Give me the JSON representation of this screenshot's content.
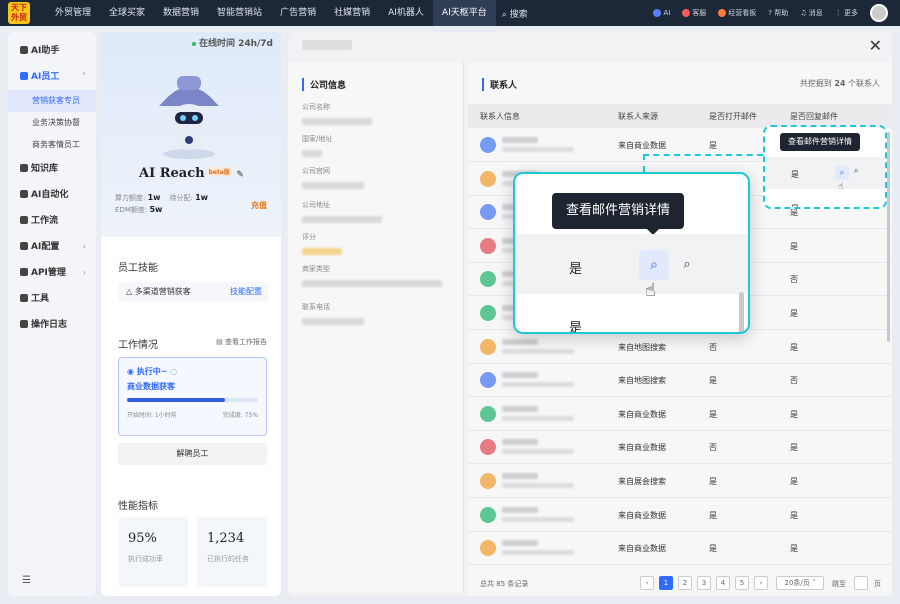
{
  "topnav": {
    "logo_text": "天下\n外贸",
    "items": [
      "外贸管理",
      "全球买家",
      "数据营销",
      "智能营销站",
      "广告营销",
      "社媒营销",
      "AI机器人",
      "AI天枢平台"
    ],
    "search": "搜索",
    "right": [
      "AI",
      "客服",
      "经营看板",
      "帮助",
      "消息",
      "更多"
    ]
  },
  "sidebar": {
    "items": [
      {
        "label": "AI助手",
        "chev": ""
      },
      {
        "label": "AI员工",
        "chev": "˅"
      },
      {
        "label": "知识库",
        "chev": ""
      },
      {
        "label": "AI自动化",
        "chev": ""
      },
      {
        "label": "工作流",
        "chev": ""
      },
      {
        "label": "AI配置",
        "chev": "›"
      },
      {
        "label": "API管理",
        "chev": "›"
      },
      {
        "label": "工具",
        "chev": ""
      },
      {
        "label": "操作日志",
        "chev": ""
      }
    ],
    "subitems": [
      "营销获客专员",
      "业务决策协督",
      "商务客情员工"
    ],
    "menu_icon": "☰"
  },
  "profile": {
    "online": "在线时间 24h/7d",
    "name": "AI Reach",
    "beta": "beta版",
    "quota1_label": "算力额度:",
    "quota1_value": "1w",
    "quota2_label": "待分配:",
    "quota2_value": "1w",
    "quota3_label": "EDM额度:",
    "quota3_value": "5w",
    "recharge": "充值",
    "skills_title": "员工技能",
    "skill": "多渠道营销获客",
    "skill_config": "技能配置",
    "work_title": "工作情况",
    "report_link": "查看工作报告",
    "status": "执行中~",
    "task": "商业数据获客",
    "progress": 0.75,
    "start_time": "开始时间: 1小时前",
    "completion": "完成度: 75%",
    "fire_button": "解聘员工",
    "perf_title": "性能指标",
    "kpi1_value": "95%",
    "kpi1_label": "执行成功率",
    "kpi2_value": "1,234",
    "kpi2_label": "已执行的任务"
  },
  "company": {
    "title": "公司信息",
    "fields": [
      "公司名称",
      "国家/地址",
      "公司官网",
      "公司地址",
      "评分",
      "商家类型",
      "联系电话"
    ]
  },
  "contacts": {
    "title": "联系人",
    "count_prefix": "共挖掘到",
    "count": "24",
    "count_suffix": "个联系人",
    "headers": [
      "联系人信息",
      "联系人来源",
      "是否打开邮件",
      "是否回复邮件"
    ],
    "rows": [
      {
        "src": "来自商业数据",
        "open": "是",
        "reply": "",
        "color": "#4a7cf0"
      },
      {
        "src": "",
        "open": "",
        "reply": "",
        "color": "#f0a23a"
      },
      {
        "src": "",
        "open": "",
        "reply": "是",
        "color": "#4a7cf0"
      },
      {
        "src": "",
        "open": "",
        "reply": "是",
        "color": "#e2525c"
      },
      {
        "src": "",
        "open": "",
        "reply": "否",
        "color": "#2bb673"
      },
      {
        "src": "",
        "open": "",
        "reply": "是",
        "color": "#2bb673"
      },
      {
        "src": "来自地图搜索",
        "open": "否",
        "reply": "是",
        "color": "#f0a23a"
      },
      {
        "src": "来自地图搜索",
        "open": "是",
        "reply": "否",
        "color": "#4a7cf0"
      },
      {
        "src": "来自商业数据",
        "open": "是",
        "reply": "是",
        "color": "#2bb673"
      },
      {
        "src": "来自商业数据",
        "open": "否",
        "reply": "是",
        "color": "#e2525c"
      },
      {
        "src": "来自展会搜索",
        "open": "是",
        "reply": "是",
        "color": "#f0a23a"
      },
      {
        "src": "来自商业数据",
        "open": "是",
        "reply": "是",
        "color": "#2bb673"
      },
      {
        "src": "来自商业数据",
        "open": "是",
        "reply": "是",
        "color": "#f0a23a"
      }
    ],
    "total": "总共 85 条记录",
    "pages": [
      "‹",
      "1",
      "2",
      "3",
      "4",
      "5",
      "›"
    ],
    "page_size": "20条/页 ˅",
    "goto": "跳至",
    "page_unit": "页"
  },
  "tooltip": {
    "text": "查看邮件营销详情",
    "yes": "是",
    "view_icon": "⌕",
    "scan_icon": "⌕"
  },
  "close_icon": "✕"
}
